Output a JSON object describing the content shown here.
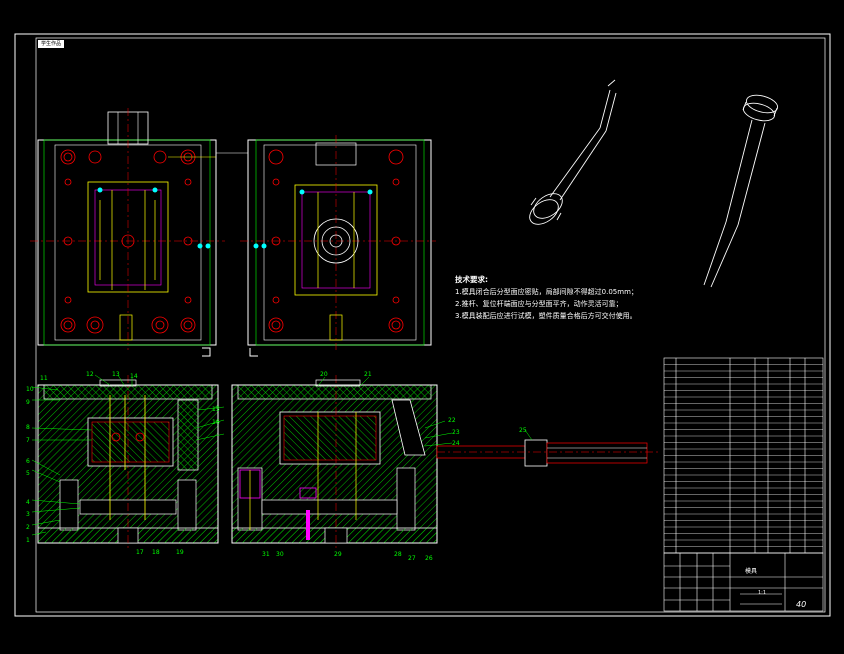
{
  "drawing": {
    "sheet_tag": "学生作品",
    "notes_title": "技术要求:",
    "notes": [
      "1.模具闭合后分型面应密贴，局部间隙不得超过0.05mm；",
      "2.推杆、复位杆端面应与分型面平齐，动作灵活可靠；",
      "3.模具装配后应进行试模，塑件质量合格后方可交付使用。"
    ],
    "front_view_labels": [
      "1",
      "2",
      "3",
      "4",
      "5",
      "6",
      "7",
      "8",
      "9",
      "10",
      "11",
      "12",
      "13",
      "14",
      "15",
      "16",
      "17",
      "18",
      "19"
    ],
    "side_view_labels": [
      "20",
      "21",
      "22",
      "23",
      "24",
      "25",
      "26",
      "27",
      "28",
      "29",
      "30",
      "31"
    ],
    "title_block": {
      "name_cell": "模具",
      "scale": "1:1",
      "sheet_no": "40"
    },
    "colors": {
      "background": "#000000",
      "outline": "#ffffff",
      "hatch": "#00ff00",
      "centerline": "#ff0000",
      "part": "#ffff00",
      "accent": "#00ffff",
      "magenta": "#ff00ff"
    }
  }
}
